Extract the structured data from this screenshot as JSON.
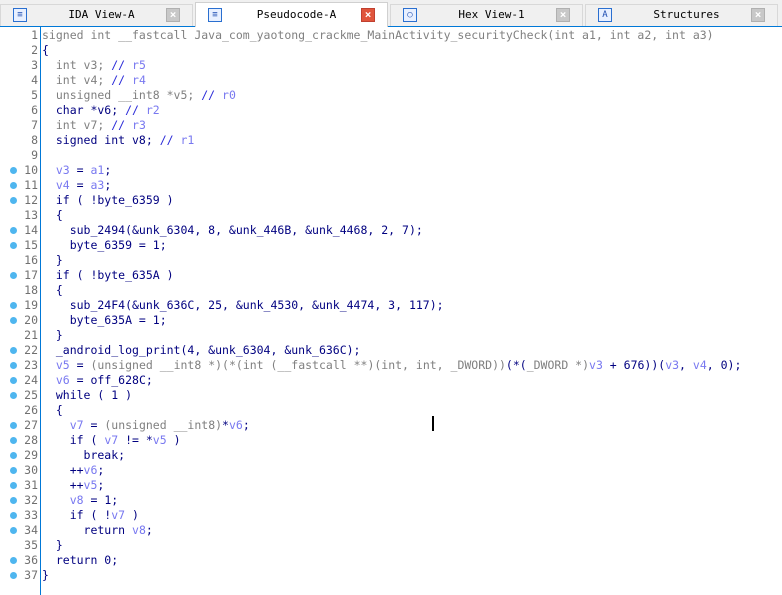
{
  "tabs": [
    {
      "label": "IDA View-A",
      "icon": "ida-view-icon",
      "active": false
    },
    {
      "label": "Pseudocode-A",
      "icon": "pseudocode-icon",
      "active": true
    },
    {
      "label": "Hex View-1",
      "icon": "hex-view-icon",
      "active": false
    },
    {
      "label": "Structures",
      "icon": "structures-icon",
      "active": false
    }
  ],
  "colors": {
    "accent": "#0078d7",
    "breakpoint_dot": "#4fb6ef",
    "code": "#000080",
    "greyed": "#808080",
    "variable": "#7878f0"
  },
  "lines": [
    {
      "num": "1",
      "dot": false,
      "segs": [
        [
          "signed int __fastcall Java_com_yaotong_crackme_MainActivity_securityCheck(int a1, int a2, int a3)",
          "g"
        ]
      ]
    },
    {
      "num": "2",
      "dot": false,
      "segs": [
        [
          "{",
          "n"
        ]
      ]
    },
    {
      "num": "3",
      "dot": false,
      "segs": [
        [
          "  int v3; ",
          "g"
        ],
        [
          "// ",
          "c"
        ],
        [
          "r5",
          "v"
        ]
      ]
    },
    {
      "num": "4",
      "dot": false,
      "segs": [
        [
          "  int v4; ",
          "g"
        ],
        [
          "// ",
          "c"
        ],
        [
          "r4",
          "v"
        ]
      ]
    },
    {
      "num": "5",
      "dot": false,
      "segs": [
        [
          "  unsigned __int8 *v5; ",
          "g"
        ],
        [
          "// ",
          "c"
        ],
        [
          "r0",
          "v"
        ]
      ]
    },
    {
      "num": "6",
      "dot": false,
      "segs": [
        [
          "  char *v6; ",
          "n"
        ],
        [
          "// ",
          "c"
        ],
        [
          "r2",
          "v"
        ]
      ]
    },
    {
      "num": "7",
      "dot": false,
      "segs": [
        [
          "  int v7; ",
          "g"
        ],
        [
          "// ",
          "c"
        ],
        [
          "r3",
          "v"
        ]
      ]
    },
    {
      "num": "8",
      "dot": false,
      "segs": [
        [
          "  signed int v8; ",
          "n"
        ],
        [
          "// ",
          "c"
        ],
        [
          "r1",
          "v"
        ]
      ]
    },
    {
      "num": "9",
      "dot": false,
      "segs": []
    },
    {
      "num": "10",
      "dot": true,
      "segs": [
        [
          "  ",
          "n"
        ],
        [
          "v3",
          "v"
        ],
        [
          " = ",
          "n"
        ],
        [
          "a1",
          "v"
        ],
        [
          ";",
          "n"
        ]
      ]
    },
    {
      "num": "11",
      "dot": true,
      "segs": [
        [
          "  ",
          "n"
        ],
        [
          "v4",
          "v"
        ],
        [
          " = ",
          "n"
        ],
        [
          "a3",
          "v"
        ],
        [
          ";",
          "n"
        ]
      ]
    },
    {
      "num": "12",
      "dot": true,
      "segs": [
        [
          "  if ( !byte_6359 )",
          "n"
        ]
      ]
    },
    {
      "num": "13",
      "dot": false,
      "segs": [
        [
          "  {",
          "n"
        ]
      ]
    },
    {
      "num": "14",
      "dot": true,
      "segs": [
        [
          "    sub_2494(&unk_6304, 8, &unk_446B, &unk_4468, 2, 7);",
          "n"
        ]
      ]
    },
    {
      "num": "15",
      "dot": true,
      "segs": [
        [
          "    byte_6359 = 1;",
          "n"
        ]
      ]
    },
    {
      "num": "16",
      "dot": false,
      "segs": [
        [
          "  }",
          "n"
        ]
      ]
    },
    {
      "num": "17",
      "dot": true,
      "segs": [
        [
          "  if ( !byte_635A )",
          "n"
        ]
      ]
    },
    {
      "num": "18",
      "dot": false,
      "segs": [
        [
          "  {",
          "n"
        ]
      ]
    },
    {
      "num": "19",
      "dot": true,
      "segs": [
        [
          "    sub_24F4(&unk_636C, 25, &unk_4530, &unk_4474, 3, 117);",
          "n"
        ]
      ]
    },
    {
      "num": "20",
      "dot": true,
      "segs": [
        [
          "    byte_635A = 1;",
          "n"
        ]
      ]
    },
    {
      "num": "21",
      "dot": false,
      "segs": [
        [
          "  }",
          "n"
        ]
      ]
    },
    {
      "num": "22",
      "dot": true,
      "segs": [
        [
          "  _android_log_print(4, &unk_6304, &unk_636C);",
          "n"
        ]
      ]
    },
    {
      "num": "23",
      "dot": true,
      "segs": [
        [
          "  ",
          "n"
        ],
        [
          "v5",
          "v"
        ],
        [
          " = ",
          "n"
        ],
        [
          "(unsigned __int8 *)(*(int (__fastcall **)(int, int, _DWORD))",
          "g"
        ],
        [
          "(*(",
          "n"
        ],
        [
          "_DWORD *)",
          "g"
        ],
        [
          "v3",
          "v"
        ],
        [
          " + 676))(",
          "n"
        ],
        [
          "v3",
          "v"
        ],
        [
          ", ",
          "n"
        ],
        [
          "v4",
          "v"
        ],
        [
          ", 0);",
          "n"
        ]
      ]
    },
    {
      "num": "24",
      "dot": true,
      "segs": [
        [
          "  ",
          "n"
        ],
        [
          "v6",
          "v"
        ],
        [
          " = off_628C;",
          "n"
        ]
      ]
    },
    {
      "num": "25",
      "dot": true,
      "segs": [
        [
          "  while ( 1 )",
          "n"
        ]
      ]
    },
    {
      "num": "26",
      "dot": false,
      "segs": [
        [
          "  {",
          "n"
        ]
      ]
    },
    {
      "num": "27",
      "dot": true,
      "segs": [
        [
          "    ",
          "n"
        ],
        [
          "v7",
          "v"
        ],
        [
          " = ",
          "n"
        ],
        [
          "(unsigned __int8)",
          "g"
        ],
        [
          "*",
          "n"
        ],
        [
          "v6",
          "v"
        ],
        [
          ";",
          "n"
        ]
      ]
    },
    {
      "num": "28",
      "dot": true,
      "segs": [
        [
          "    if ( ",
          "n"
        ],
        [
          "v7",
          "v"
        ],
        [
          " != *",
          "n"
        ],
        [
          "v5",
          "v"
        ],
        [
          " )",
          "n"
        ]
      ]
    },
    {
      "num": "29",
      "dot": true,
      "segs": [
        [
          "      break;",
          "n"
        ]
      ]
    },
    {
      "num": "30",
      "dot": true,
      "segs": [
        [
          "    ++",
          "n"
        ],
        [
          "v6",
          "v"
        ],
        [
          ";",
          "n"
        ]
      ]
    },
    {
      "num": "31",
      "dot": true,
      "segs": [
        [
          "    ++",
          "n"
        ],
        [
          "v5",
          "v"
        ],
        [
          ";",
          "n"
        ]
      ]
    },
    {
      "num": "32",
      "dot": true,
      "segs": [
        [
          "    ",
          "n"
        ],
        [
          "v8",
          "v"
        ],
        [
          " = 1;",
          "n"
        ]
      ]
    },
    {
      "num": "33",
      "dot": true,
      "segs": [
        [
          "    if ( !",
          "n"
        ],
        [
          "v7",
          "v"
        ],
        [
          " )",
          "n"
        ]
      ]
    },
    {
      "num": "34",
      "dot": true,
      "segs": [
        [
          "      return ",
          "n"
        ],
        [
          "v8",
          "v"
        ],
        [
          ";",
          "n"
        ]
      ]
    },
    {
      "num": "35",
      "dot": false,
      "segs": [
        [
          "  }",
          "n"
        ]
      ]
    },
    {
      "num": "36",
      "dot": true,
      "segs": [
        [
          "  return 0;",
          "n"
        ]
      ]
    },
    {
      "num": "37",
      "dot": true,
      "segs": [
        [
          "}",
          "n"
        ]
      ]
    }
  ]
}
